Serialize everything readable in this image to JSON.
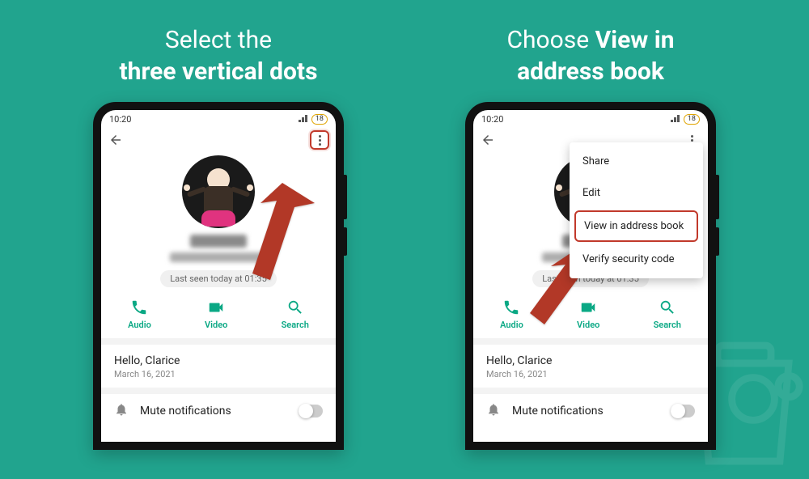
{
  "captions": {
    "left_line1": "Select the",
    "left_line2_bold": "three vertical dots",
    "right_prefix": "Choose ",
    "right_bold1": "View in",
    "right_bold2": "address book"
  },
  "status": {
    "time": "10:20",
    "battery": "18"
  },
  "profile": {
    "last_seen": "Last seen today at 01:35"
  },
  "actions": {
    "audio": "Audio",
    "video": "Video",
    "search": "Search"
  },
  "message": {
    "text": "Hello, Clarice",
    "date": "March 16, 2021"
  },
  "mute": {
    "label": "Mute notifications"
  },
  "menu": {
    "share": "Share",
    "edit": "Edit",
    "view_in_address_book": "View in address book",
    "verify_security_code": "Verify security code"
  }
}
